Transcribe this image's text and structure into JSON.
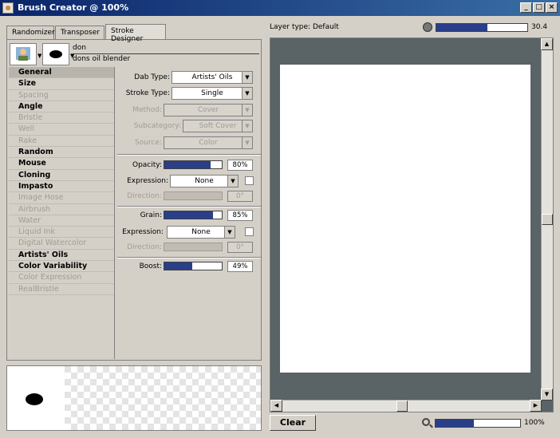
{
  "window": {
    "title": "Brush Creator @ 100%",
    "min": "_",
    "max": "□",
    "close": "×"
  },
  "tabs": [
    {
      "label": "Randomizer"
    },
    {
      "label": "Transposer"
    },
    {
      "label": "Stroke Designer",
      "active": true
    }
  ],
  "brush": {
    "category": "don",
    "variant": "dons oil blender"
  },
  "categories": [
    {
      "label": "General",
      "state": "enabled",
      "selected": true
    },
    {
      "label": "Size",
      "state": "enabled"
    },
    {
      "label": "Spacing",
      "state": "disabled"
    },
    {
      "label": "Angle",
      "state": "enabled"
    },
    {
      "label": "Bristle",
      "state": "disabled"
    },
    {
      "label": "Well",
      "state": "disabled"
    },
    {
      "label": "Rake",
      "state": "disabled"
    },
    {
      "label": "Random",
      "state": "enabled"
    },
    {
      "label": "Mouse",
      "state": "enabled"
    },
    {
      "label": "Cloning",
      "state": "enabled"
    },
    {
      "label": "Impasto",
      "state": "enabled"
    },
    {
      "label": "Image Hose",
      "state": "disabled"
    },
    {
      "label": "Airbrush",
      "state": "disabled"
    },
    {
      "label": "Water",
      "state": "disabled"
    },
    {
      "label": "Liquid Ink",
      "state": "disabled"
    },
    {
      "label": "Digital Watercolor",
      "state": "disabled"
    },
    {
      "label": "Artists' Oils",
      "state": "enabled"
    },
    {
      "label": "Color Variability",
      "state": "enabled"
    },
    {
      "label": "Color Expression",
      "state": "disabled"
    },
    {
      "label": "RealBristle",
      "state": "disabled"
    }
  ],
  "general": {
    "dab_type": {
      "label": "Dab Type:",
      "value": "Artists' Oils"
    },
    "stroke_type": {
      "label": "Stroke Type:",
      "value": "Single"
    },
    "method": {
      "label": "Method:",
      "value": "Cover"
    },
    "subcategory": {
      "label": "Subcategory:",
      "value": "Soft Cover"
    },
    "source": {
      "label": "Source:",
      "value": "Color"
    },
    "opacity": {
      "label": "Opacity:",
      "value": "80%",
      "level": 0.8
    },
    "opacity_expression": {
      "label": "Expression:",
      "value": "None"
    },
    "opacity_direction": {
      "label": "Direction:",
      "value": "0°",
      "level": 0
    },
    "grain": {
      "label": "Grain:",
      "value": "85%",
      "level": 0.85
    },
    "grain_expression": {
      "label": "Expression:",
      "value": "None"
    },
    "grain_direction": {
      "label": "Direction:",
      "value": "0°",
      "level": 0
    },
    "boost": {
      "label": "Boost:",
      "value": "49%",
      "level": 0.49
    }
  },
  "canvas": {
    "layer_type": "Layer type: Default",
    "top_slider_value": "30.4",
    "top_slider_level": 0.56,
    "clear_label": "Clear",
    "zoom_value": "100%",
    "zoom_level": 0.45
  },
  "colors": {
    "slider_fill": "#2a3f8a",
    "canvas_bg": "#5a6366",
    "title_bar": "#0a246a"
  }
}
